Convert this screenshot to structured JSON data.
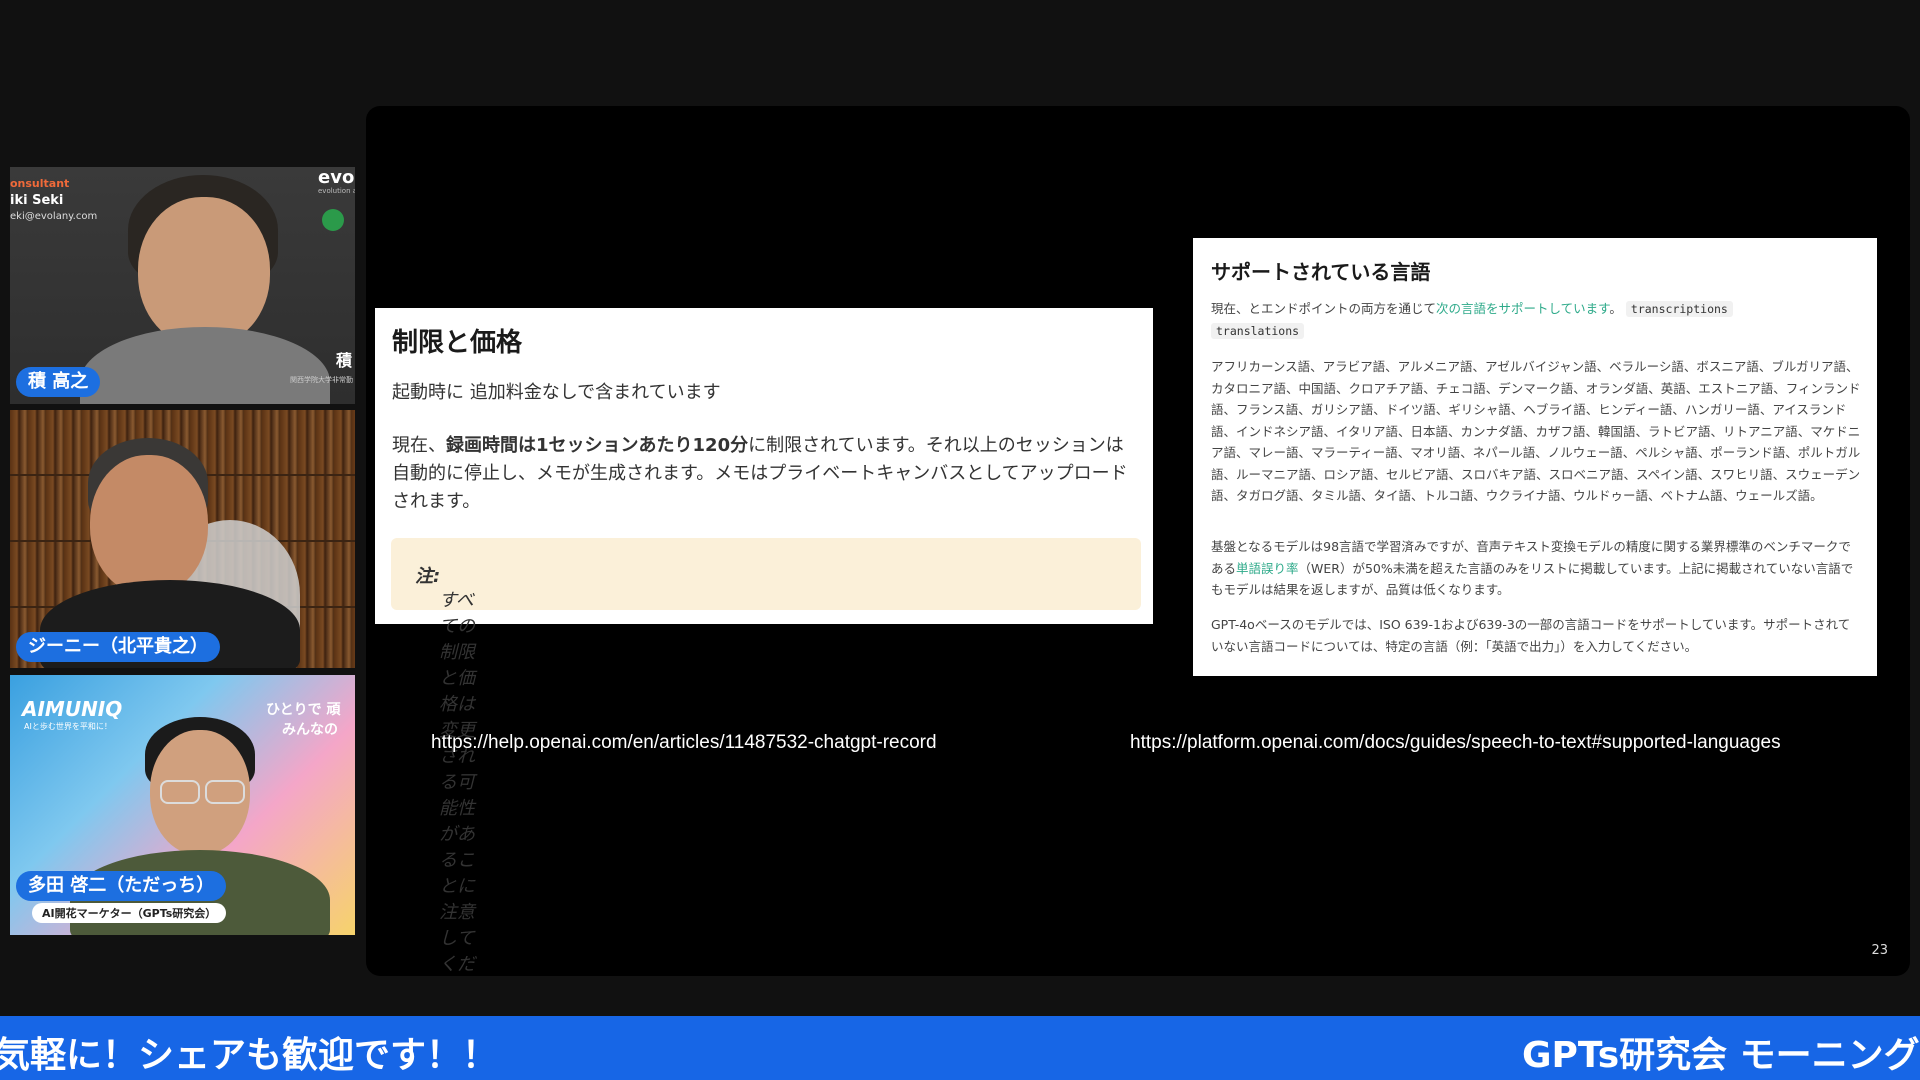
{
  "participants": [
    {
      "name": "積 高之",
      "overlay_role": "onsultant",
      "overlay_name": "iki Seki",
      "overlay_email": "eki@evolany.com",
      "brand": "evo",
      "brand_sub": "evolution a",
      "side_char": "積",
      "affiliation": "関西学院大学非常勤"
    },
    {
      "name": "ジーニー（北平貴之）"
    },
    {
      "name": "多田 啓二（ただっち）",
      "subtitle": "AI開花マーケター（GPTs研究会）",
      "bg_logo": "AIMUNIQ",
      "bg_logo_sub": "AIと歩む世界を平和に！",
      "bg_tagline_1": "ひとりで 頑",
      "bg_tagline_2": "みんなの"
    }
  ],
  "slide": {
    "left_card": {
      "title": "制限と価格",
      "line1": "起動時に 追加料金なしで含まれています",
      "para_prefix": "現在、",
      "para_bold": "録画時間は1セッションあたり120分",
      "para_suffix": "に制限されています。それ以上のセッションは自動的に停止し、メモが生成されます。メモはプライベートキャンバスとしてアップロードされます。",
      "note_label": "注:",
      "note_text": " すべての制限と価格は変更される可能性があることに注意してください。"
    },
    "right_card": {
      "title": "サポートされている言語",
      "intro_prefix": "現在、とエンドポイントの両方を通じて",
      "intro_link": "次の言語をサポートしています",
      "intro_suffix": "。",
      "code1": "transcriptions",
      "code2": "translations",
      "languages": "アフリカーンス語、アラビア語、アルメニア語、アゼルバイジャン語、ベラルーシ語、ボスニア語、ブルガリア語、カタロニア語、中国語、クロアチア語、チェコ語、デンマーク語、オランダ語、英語、エストニア語、フィンランド語、フランス語、ガリシア語、ドイツ語、ギリシャ語、ヘブライ語、ヒンディー語、ハンガリー語、アイスランド語、インドネシア語、イタリア語、日本語、カンナダ語、カザフ語、韓国語、ラトビア語、リトアニア語、マケドニア語、マレー語、マラーティー語、マオリ語、ネパール語、ノルウェー語、ペルシャ語、ポーランド語、ポルトガル語、ルーマニア語、ロシア語、セルビア語、スロバキア語、スロベニア語、スペイン語、スワヒリ語、スウェーデン語、タガログ語、タミル語、タイ語、トルコ語、ウクライナ語、ウルドゥー語、ベトナム語、ウェールズ語。",
      "base_prefix": "基盤となるモデルは98言語で学習済みですが、音声テキスト変換モデルの精度に関する業界標準のベンチマークである",
      "base_link": "単語誤り率",
      "base_suffix": "（WER）が50%未満を超えた言語のみをリストに掲載しています。上記に掲載されていない言語でもモデルは結果を返しますが、品質は低くなります。",
      "gpt_note": "GPT-4oベースのモデルでは、ISO 639-1および639-3の一部の言語コードをサポートしています。サポートされていない言語コードについては、特定の言語（例：「英語で出力」）を入力してください。"
    },
    "url_left": "https://help.openai.com/en/articles/11487532-chatgpt-record",
    "url_right": "https://platform.openai.com/docs/guides/speech-to-text#supported-languages",
    "page_number": "23"
  },
  "ticker": {
    "left_text": "気軽に！シェアも歓迎です！！",
    "right_text": "GPTs研究会 モーニング"
  },
  "colors": {
    "tag_blue": "#1d6fe0",
    "ticker_blue": "#1766e6",
    "link_green": "#2eaa8a",
    "note_bg": "#fbf0d9"
  }
}
